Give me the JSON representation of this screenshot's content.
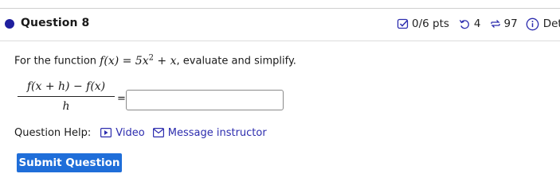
{
  "question": {
    "title": "Question 8"
  },
  "meta": {
    "points": "0/6 pts",
    "retries": "4",
    "attempts": "97",
    "details": "Deta"
  },
  "prompt": {
    "prefix": "For the function",
    "function_math": "f(x) = 5x",
    "exponent": "2",
    "function_tail": " + x",
    "suffix": ", evaluate and simplify."
  },
  "fraction": {
    "numerator": "f(x + h) − f(x)",
    "denominator": "h",
    "equals": "="
  },
  "answer_input": {
    "value": "",
    "placeholder": ""
  },
  "help": {
    "label": "Question Help:",
    "video": "Video",
    "message": "Message instructor"
  },
  "submit": {
    "label": "Submit Question"
  },
  "colors": {
    "dot": "#1f1f9e",
    "link": "#2c2cae",
    "button": "#1f6ed9"
  }
}
